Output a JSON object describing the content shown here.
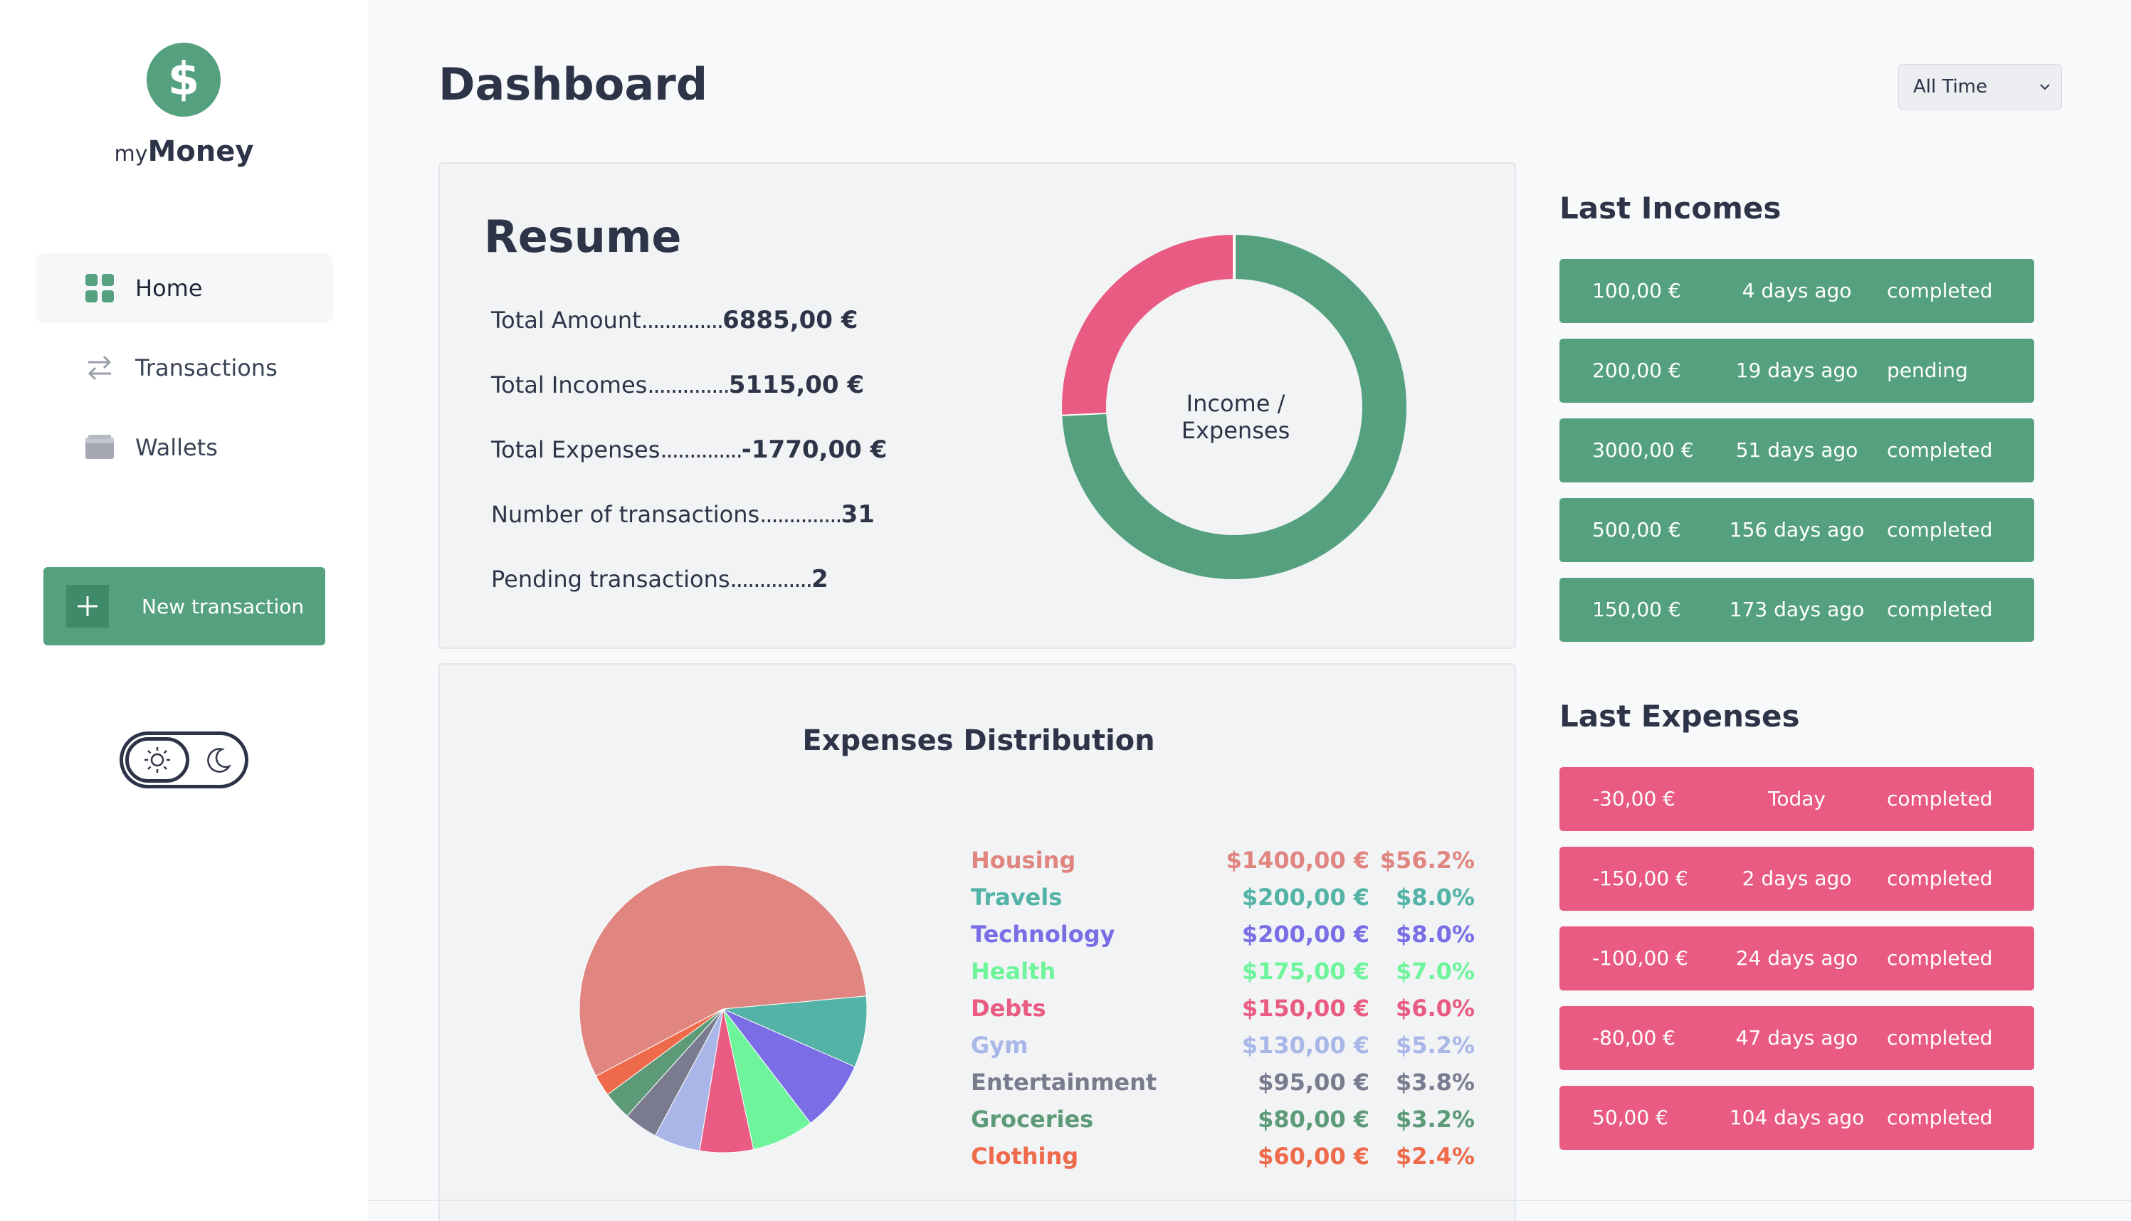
{
  "app": {
    "logo_symbol": "$",
    "name_prefix": "my",
    "name_main": "Money",
    "brand_color": "#55a17f",
    "expense_color": "#e95b82"
  },
  "sidebar": {
    "items": [
      {
        "label": "Home",
        "icon": "grid-icon",
        "active": true
      },
      {
        "label": "Transactions",
        "icon": "arrows-swap-icon",
        "active": false
      },
      {
        "label": "Wallets",
        "icon": "wallet-icon",
        "active": false
      }
    ],
    "new_transaction_label": "New transaction",
    "theme_toggle": {
      "options": [
        "sun-icon",
        "moon-icon"
      ],
      "selected": "light"
    }
  },
  "header": {
    "title": "Dashboard",
    "time_filter": "All Time"
  },
  "resume": {
    "title": "Resume",
    "stats": [
      {
        "label": "Total Amount",
        "dots": "..............",
        "value": "6885,00 €"
      },
      {
        "label": "Total Incomes",
        "dots": "..............",
        "value": "5115,00 €"
      },
      {
        "label": "Total Expenses",
        "dots": "..............",
        "value": "-1770,00 €"
      },
      {
        "label": "Number of transactions",
        "dots": "..............",
        "value": "31"
      },
      {
        "label": "Pending transactions",
        "dots": "..............",
        "value": "2"
      }
    ],
    "donut_label": "Income / Expenses"
  },
  "chart_data": [
    {
      "type": "pie",
      "variant": "donut",
      "title": "Income / Expenses",
      "categories": [
        "Income",
        "Expenses"
      ],
      "values": [
        5115,
        1770
      ],
      "colors": [
        "#55a17f",
        "#e95b82"
      ]
    },
    {
      "type": "pie",
      "title": "Expenses Distribution",
      "categories": [
        "Housing",
        "Travels",
        "Technology",
        "Health",
        "Debts",
        "Gym",
        "Entertainment",
        "Groceries",
        "Clothing"
      ],
      "amounts": [
        "$1400,00 €",
        "$200,00 €",
        "$200,00 €",
        "$175,00 €",
        "$150,00 €",
        "$130,00 €",
        "$95,00 €",
        "$80,00 €",
        "$60,00 €"
      ],
      "percents": [
        "$56.2%",
        "$8.0%",
        "$8.0%",
        "$7.0%",
        "$6.0%",
        "$5.2%",
        "$3.8%",
        "$3.2%",
        "$2.4%"
      ],
      "values": [
        56.2,
        8.0,
        8.0,
        7.0,
        6.0,
        5.2,
        3.8,
        3.2,
        2.4
      ],
      "colors": [
        "#e08580",
        "#52b3a6",
        "#7b6de6",
        "#6ef59c",
        "#e95b82",
        "#a9b7e8",
        "#7b7b8f",
        "#5c9a78",
        "#ee6a4a"
      ]
    }
  ],
  "last_incomes": {
    "title": "Last Incomes",
    "rows": [
      {
        "amount": "100,00 €",
        "when": "4 days ago",
        "status": "completed"
      },
      {
        "amount": "200,00 €",
        "when": "19 days ago",
        "status": "pending"
      },
      {
        "amount": "3000,00 €",
        "when": "51 days ago",
        "status": "completed"
      },
      {
        "amount": "500,00 €",
        "when": "156 days ago",
        "status": "completed"
      },
      {
        "amount": "150,00 €",
        "when": "173 days ago",
        "status": "completed"
      }
    ]
  },
  "last_expenses": {
    "title": "Last Expenses",
    "rows": [
      {
        "amount": "-30,00 €",
        "when": "Today",
        "status": "completed"
      },
      {
        "amount": "-150,00 €",
        "when": "2 days ago",
        "status": "completed"
      },
      {
        "amount": "-100,00 €",
        "when": "24 days ago",
        "status": "completed"
      },
      {
        "amount": "-80,00 €",
        "when": "47 days ago",
        "status": "completed"
      },
      {
        "amount": "50,00 €",
        "when": "104 days ago",
        "status": "completed"
      }
    ]
  }
}
